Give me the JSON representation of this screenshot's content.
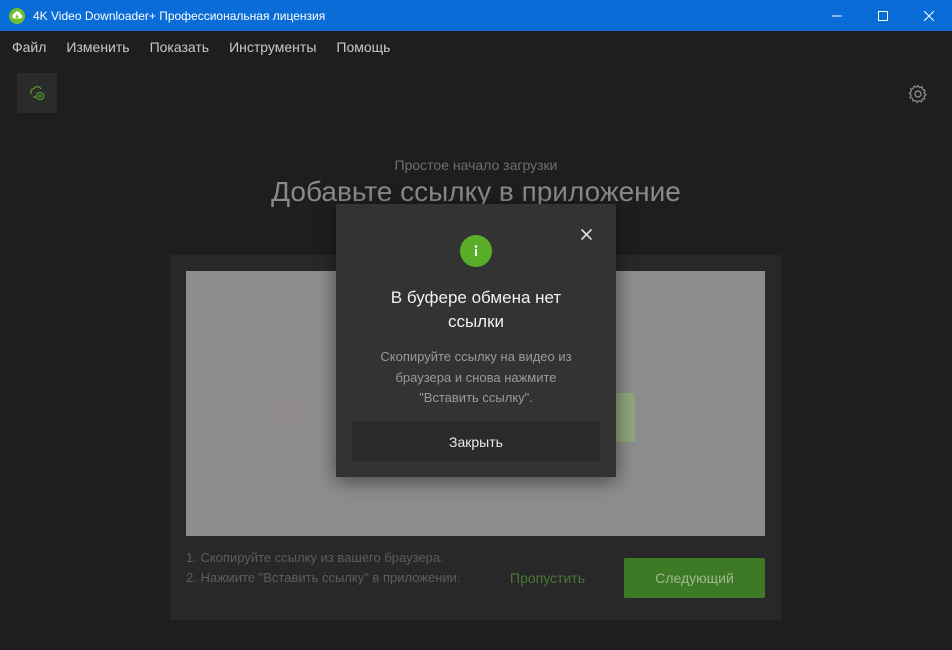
{
  "window": {
    "title": "4K Video Downloader+ Профессиональная лицензия"
  },
  "menu": {
    "items": [
      "Файл",
      "Изменить",
      "Показать",
      "Инструменты",
      "Помощь"
    ]
  },
  "toolbar": {
    "paste_icon": "link-plus-icon",
    "settings_icon": "gear-icon"
  },
  "main": {
    "subtitle": "Простое начало загрузки",
    "heading": "Добавьте ссылку в приложение",
    "steps": {
      "line1": "1. Скопируйте ссылку из вашего браузера.",
      "line2": "2. Нажмите \"Вставить ссылку\" в приложении."
    },
    "skip_label": "Пропустить",
    "next_label": "Следующий"
  },
  "dialog": {
    "icon": "info-icon",
    "title": "В буфере обмена нет ссылки",
    "message": "Скопируйте ссылку на видео из браузера и снова нажмите \"Вставить ссылку\".",
    "close_label": "Закрыть"
  },
  "colors": {
    "titlebar": "#0a6cd6",
    "accent_green": "#5aad28",
    "background": "#1e1e1e"
  }
}
